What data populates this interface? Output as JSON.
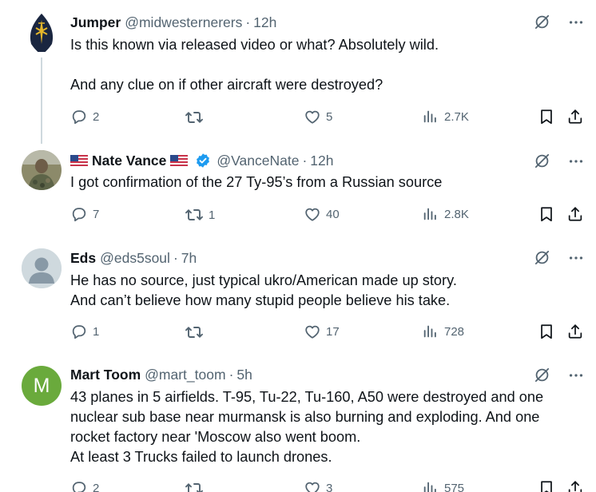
{
  "tweets": [
    {
      "name": "Jumper",
      "handle": "@midwesternerers",
      "sep": "·",
      "time": "12h",
      "text": "Is this known via released video or what? Absolutely wild.\n\nAnd any clue on if other aircraft were destroyed?",
      "replies": "2",
      "retweets": "",
      "likes": "5",
      "views": "2.7K"
    },
    {
      "name": "Nate Vance",
      "handle": "@VanceNate",
      "sep": "·",
      "time": "12h",
      "text": "I got confirmation of the 27 Ty-95’s from a Russian source",
      "replies": "7",
      "retweets": "1",
      "likes": "40",
      "views": "2.8K"
    },
    {
      "name": "Eds",
      "handle": "@eds5soul",
      "sep": "·",
      "time": "7h",
      "text": "He has no source, just typical ukro/American made up story.\nAnd can’t believe how many stupid people believe his take.",
      "replies": "1",
      "retweets": "",
      "likes": "17",
      "views": "728"
    },
    {
      "name": "Mart Toom",
      "handle": "@mart_toom",
      "sep": "·",
      "time": "5h",
      "avatar_letter": "M",
      "text": "43 planes in 5 airfields. T-95, Tu-22, Tu-160, A50 were destroyed and one\nnuclear sub base near murmansk is also burning and exploding. And one\nrocket factory near 'Moscow also went boom.\nAt least 3 Trucks failed to launch drones.",
      "replies": "2",
      "retweets": "",
      "likes": "3",
      "views": "575"
    }
  ],
  "colors": {
    "text": "#0f1419",
    "secondary": "#536471",
    "verified": "#1d9bf0",
    "thread_line": "#cfd9de",
    "green_avatar": "#6aaa3c"
  },
  "icons": [
    "grok-icon",
    "more-icon",
    "reply-icon",
    "retweet-icon",
    "like-icon",
    "views-icon",
    "bookmark-icon",
    "share-icon",
    "verified-badge-icon",
    "us-flag-icon"
  ]
}
